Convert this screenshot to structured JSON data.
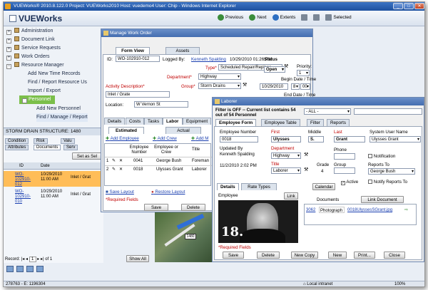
{
  "browser": {
    "title": "VUEWorks® 2010.8.122.0 Project: VUEWorks2010 Host: vuedemo4 User: Chip - Windows Internet Explorer",
    "status_left": "278763 - E: 1196304",
    "status_zone": "Local intranet",
    "zoom": "100%"
  },
  "app": {
    "logo": "VUEWorks",
    "toolbar": {
      "previous": "Previous",
      "next": "Next",
      "extents": "Extents",
      "selected": "Selected"
    }
  },
  "nav": {
    "items": [
      {
        "label": "Administration"
      },
      {
        "label": "Document Link"
      },
      {
        "label": "Service Requests"
      },
      {
        "label": "Work Orders"
      },
      {
        "label": "Resource Manager"
      },
      {
        "label": "Add New Time Records"
      },
      {
        "label": "Find / Report Resource Us"
      },
      {
        "label": "Import / Export"
      },
      {
        "label": "Personnel"
      },
      {
        "label": "Add New Personnel"
      },
      {
        "label": "Find / Manage / Report"
      }
    ]
  },
  "storm": {
    "title": "STORM DRAIN STRUCTURE: 1480",
    "tabs": [
      "Condition",
      "Risk",
      "Valu",
      "Attributes",
      "Documents",
      "Serv"
    ],
    "set_btn": "Set as Sel",
    "columns": [
      "ID",
      "Date",
      ""
    ],
    "rows": [
      {
        "id": "WO-102910-012",
        "date": "10/29/2010 11:00 AM",
        "desc": "Inlet / Grat",
        "selected": true
      },
      {
        "id": "WO-102910-010",
        "date": "10/29/2010 11:00 AM",
        "desc": "Inlet / Grat",
        "selected": false
      }
    ],
    "record_label": "Record:",
    "record_num": "1",
    "record_of": "of",
    "record_total": "1",
    "show_all": "Show All"
  },
  "workorder": {
    "title": "Manage Work Order",
    "tabs": [
      "Form View",
      "Assets"
    ],
    "id_label": "ID:",
    "id_value": "WO-102910-012",
    "logged_by_label": "Logged By:",
    "logged_by_name": "Kenneth Spalding",
    "logged_date": "10/29/2010 01:26 PM",
    "type_label": "Type*",
    "type_value": "Scheduled Repair/Replace",
    "department_label": "Department*",
    "department_value": "Highway",
    "activity_label": "Activity Description*",
    "activity_value": "Inlet / Grate",
    "group_label": "Group*",
    "group_value": "Storm Drains",
    "location_label": "Location:",
    "location_value": "W Vernon St",
    "status_label": "Status",
    "status_value": "Open",
    "priority_label": "Priority:",
    "priority_value": "1",
    "begin_label": "Begin Date / Time",
    "begin_date": "10/29/2010",
    "begin_hour": "8",
    "begin_min": "00",
    "begin_ampm": "AM",
    "end_label": "End Date / Time",
    "subtabs": [
      "Details",
      "Costs",
      "Tasks",
      "Labor",
      "Equipment"
    ],
    "labor_tabs": [
      "Estimated",
      "Actual"
    ],
    "add_employee": "Add Employee",
    "add_crew": "Add Crew",
    "add_mgr": "Add M",
    "labor_columns": [
      "Employee Number",
      "Employee or Crew",
      "Title"
    ],
    "labor_rows": [
      {
        "n": "1",
        "num": "0041",
        "name": "George Bush",
        "title": "Foreman"
      },
      {
        "n": "2",
        "num": "0018",
        "name": "Ulysses Grant",
        "title": "Laborer"
      }
    ],
    "save_layout": "Save Layout",
    "restore_layout": "Restore Layout",
    "required": "*Required Fields",
    "save": "Save",
    "delete": "Delete"
  },
  "personnel": {
    "title": "Laborer",
    "filter_text": "Filter is OFF -- Current list contains 54 out of 54 Personnel",
    "filter_value": "- ALL -",
    "tabs": [
      "Employee Form",
      "Employee Table",
      "Filter",
      "Reports"
    ],
    "emp_number_label": "Employee Number",
    "emp_number": "0018",
    "first_label": "First",
    "first": "Ulysses",
    "middle_label": "Middle",
    "middle": "S.",
    "last_label": "Last",
    "last": "Grant",
    "sysuser_label": "System User Name",
    "sysuser": "Ulysses Grant",
    "updated_label": "Updated By",
    "updated_by": "Kenneth Spalding",
    "updated_date": "11/2/2010 2:02 PM",
    "dept_label": "Department",
    "dept": "Highway",
    "phone_label": "Phone",
    "notification": "Notification",
    "title_label": "Title",
    "grade_label": "Grade",
    "grade": "4",
    "group_label": "Group",
    "reports_to_label": "Reports To",
    "reports_to": "George Bush",
    "active": "Active",
    "notify_reports": "Notify Reports To",
    "subtabs": [
      "Details",
      "Rate Types"
    ],
    "calendar": "Calendar",
    "employee_label": "Employee",
    "link_btn": "Link",
    "photo_number": "18.",
    "documents_label": "Documents",
    "link_document": "Link Document",
    "doc_id": "3062",
    "doc_type": "Photograph",
    "doc_file": "0018UlyssesSGrant.jpg",
    "required": "*Required Fields",
    "buttons": [
      "Save",
      "Delete",
      "New Copy",
      "New",
      "Print...",
      "Close"
    ]
  },
  "colors": {
    "accent": "#446db0",
    "selection": "#ffbd58",
    "nav_selected": "#7bbf4a",
    "required": "#c00000"
  }
}
